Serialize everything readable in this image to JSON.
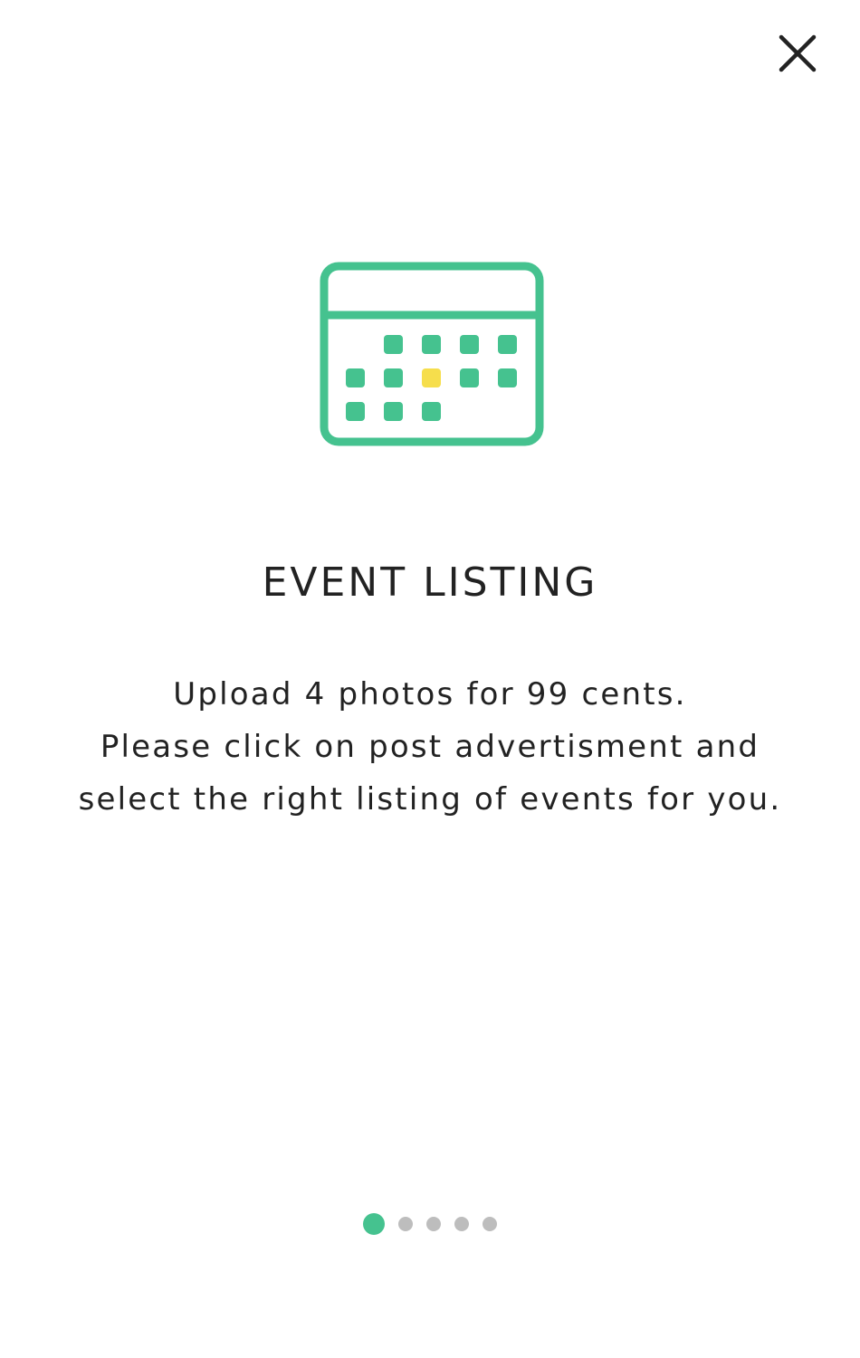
{
  "header": {
    "close_icon": "close-icon"
  },
  "hero": {
    "icon": "calendar-icon",
    "colors": {
      "primary": "#45C28F",
      "highlight": "#F6DE4C"
    }
  },
  "content": {
    "title": "EVENT LISTING",
    "description_lines": [
      "Upload 4 photos for 99 cents.",
      "Please click on post advertisment and",
      "select the right listing of events for you."
    ]
  },
  "pager": {
    "total_pages": 5,
    "current_page": 1,
    "active_color": "#45C28F",
    "inactive_color": "#BDBDBD"
  }
}
